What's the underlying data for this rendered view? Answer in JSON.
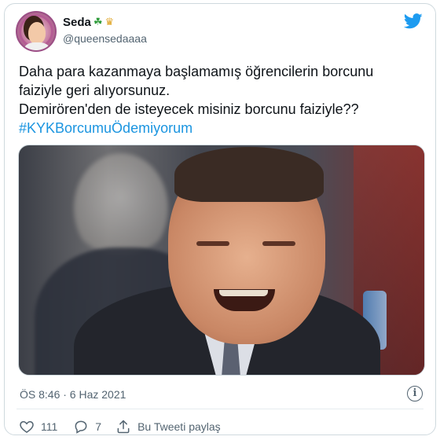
{
  "user": {
    "display_name": "Seda",
    "name_emojis": [
      "☘",
      "♛"
    ],
    "handle": "@queensedaaaa"
  },
  "tweet": {
    "lines": [
      "Daha para kazanmaya başlamamış öğrencilerin borcunu",
      "faiziyle geri alıyorsunuz.",
      "Demirören'den de isteyecek misiniz borcunu faiziyle??"
    ],
    "hashtag": "#KYKBorcumuÖdemiyorum"
  },
  "meta": {
    "timestamp": "ÖS 8:46 · 6 Haz 2021"
  },
  "actions": {
    "like_count": "111",
    "reply_count": "7",
    "share_label": "Bu Tweeti paylaş"
  },
  "colors": {
    "twitter_blue": "#1d9bf0",
    "hashtag": "#1b95e0",
    "secondary_text": "#536471",
    "border": "#cfd9de"
  },
  "icons": [
    "twitter-bird-icon",
    "info-icon",
    "heart-icon",
    "reply-bubble-icon",
    "share-icon"
  ]
}
